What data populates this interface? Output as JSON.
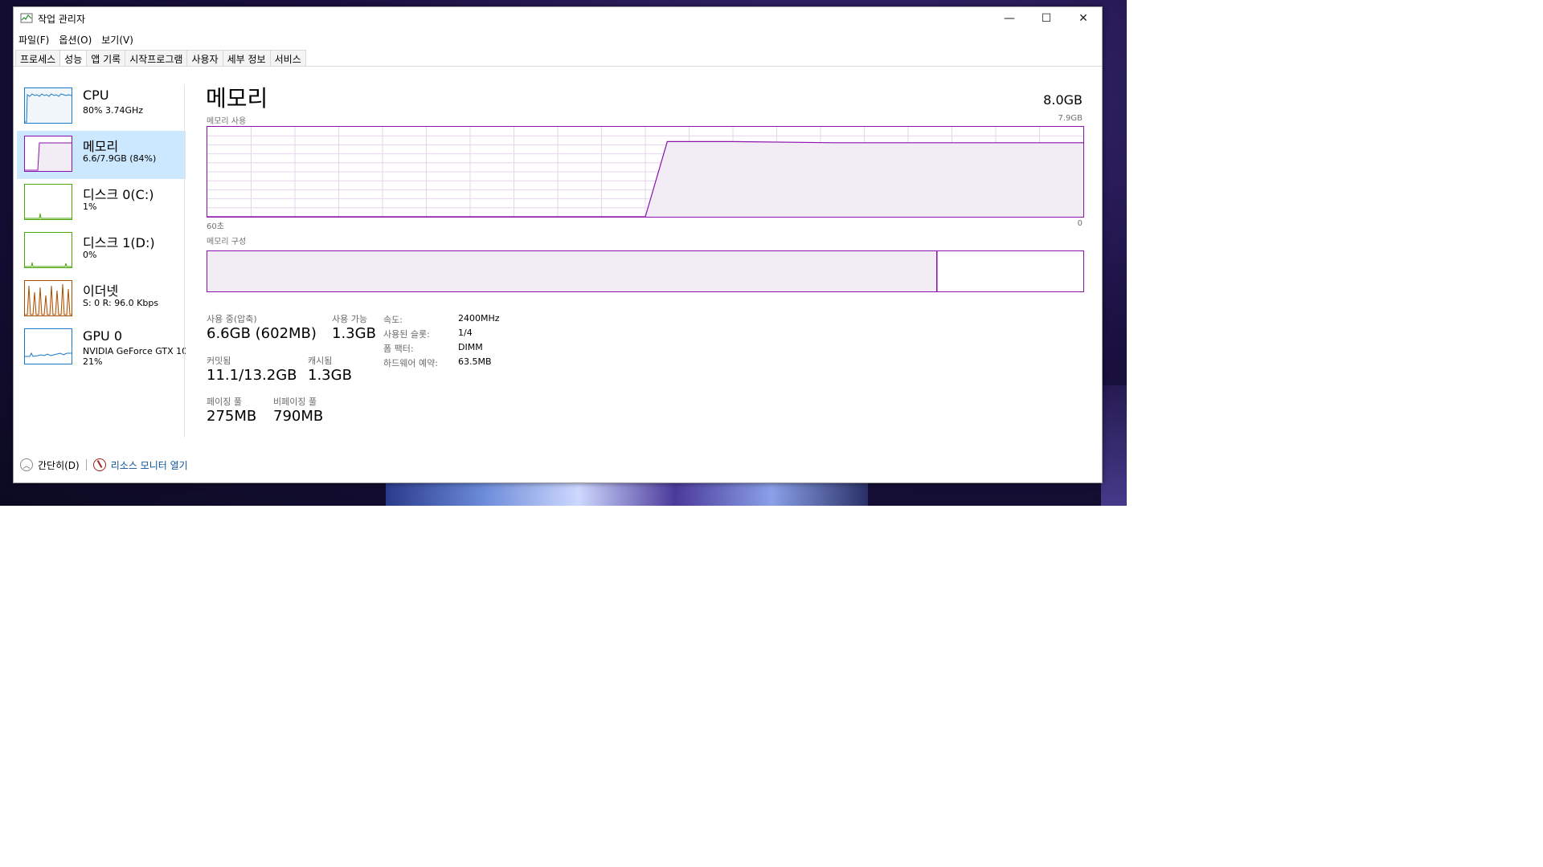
{
  "window": {
    "title": "작업 관리자",
    "controls": {
      "minimize": "—",
      "maximize": "☐",
      "close": "✕"
    }
  },
  "menu": [
    "파일(F)",
    "옵션(O)",
    "보기(V)"
  ],
  "tabs": [
    {
      "label": "프로세스",
      "active": false
    },
    {
      "label": "성능",
      "active": true
    },
    {
      "label": "앱 기록",
      "active": false
    },
    {
      "label": "시작프로그램",
      "active": false
    },
    {
      "label": "사용자",
      "active": false
    },
    {
      "label": "세부 정보",
      "active": false
    },
    {
      "label": "서비스",
      "active": false
    }
  ],
  "sidebar": {
    "items": [
      {
        "title": "CPU",
        "sub": "80%  3.74GHz",
        "sub2": "",
        "color": "#1979ca",
        "active": false
      },
      {
        "title": "메모리",
        "sub": "6.6/7.9GB (84%)",
        "sub2": "",
        "color": "#8b12ae",
        "active": true
      },
      {
        "title": "디스크 0(C:)",
        "sub": "1%",
        "sub2": "",
        "color": "#4da60c",
        "active": false
      },
      {
        "title": "디스크 1(D:)",
        "sub": "0%",
        "sub2": "",
        "color": "#4da60c",
        "active": false
      },
      {
        "title": "이더넷",
        "sub": "S: 0  R: 96.0 Kbps",
        "sub2": "",
        "color": "#a74f01",
        "active": false
      },
      {
        "title": "GPU 0",
        "sub": "NVIDIA GeForce GTX 10",
        "sub2": "21%",
        "color": "#1979ca",
        "active": false
      }
    ]
  },
  "main": {
    "title": "메모리",
    "total": "8.0GB",
    "usage_label": "메모리 사용",
    "usage_max": "7.9GB",
    "axis_left": "60초",
    "axis_right": "0",
    "composition_label": "메모리 구성",
    "accent": "#8b12ae"
  },
  "stats": {
    "in_use_label": "사용 중(압축)",
    "in_use_value": "6.6GB (602MB)",
    "available_label": "사용 가능",
    "available_value": "1.3GB",
    "committed_label": "커밋됨",
    "committed_value": "11.1/13.2GB",
    "cached_label": "캐시됨",
    "cached_value": "1.3GB",
    "paged_label": "페이징 풀",
    "paged_value": "275MB",
    "nonpaged_label": "비페이징 풀",
    "nonpaged_value": "790MB"
  },
  "details": [
    {
      "label": "속도:",
      "value": "2400MHz"
    },
    {
      "label": "사용된 슬롯:",
      "value": "1/4"
    },
    {
      "label": "폼 팩터:",
      "value": "DIMM"
    },
    {
      "label": "하드웨어 예약:",
      "value": "63.5MB"
    }
  ],
  "footer": {
    "collapse_label": "간단히(D)",
    "monitor_label": "리소스 모니터 열기"
  },
  "chart_data": {
    "type": "area",
    "title": "메모리 사용",
    "xlabel": "",
    "ylabel": "",
    "x_range_label": [
      "60초",
      "0"
    ],
    "ylim": [
      0,
      7.9
    ],
    "series": [
      {
        "name": "",
        "x": [
          60,
          30,
          28.5,
          26.5,
          24,
          17,
          0
        ],
        "y": [
          0,
          0,
          6.6,
          6.6,
          6.6,
          6.5,
          6.5
        ]
      }
    ],
    "composition": {
      "in_use_fraction": 0.833,
      "modified_fraction": 0.005,
      "standby_fraction": 0.16
    }
  }
}
